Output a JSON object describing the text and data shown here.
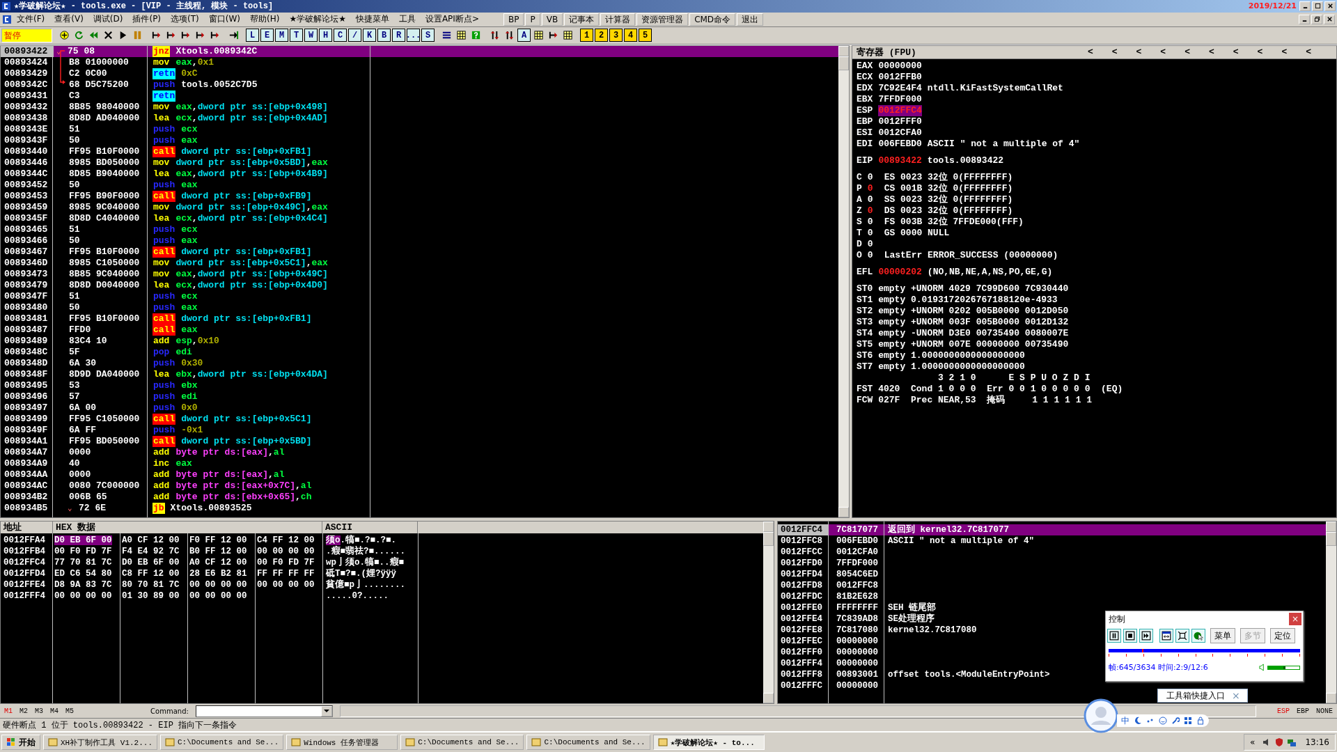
{
  "window": {
    "title": "★学破解论坛★ - tools.exe - [VIP - 主线程, 模块 - tools]",
    "clock": "2019/12/21"
  },
  "menu": {
    "items": [
      "文件(F)",
      "查看(V)",
      "调试(D)",
      "插件(P)",
      "选项(T)",
      "窗口(W)",
      "帮助(H)",
      "★学破解论坛★",
      "快捷菜单",
      "工具",
      "设置API断点>"
    ],
    "buttons": [
      "BP",
      "P",
      "VB",
      "记事本",
      "计算器",
      "资源管理器",
      "CMD命令",
      "退出"
    ]
  },
  "toolbar": {
    "status": "暂停",
    "groups": [
      [
        {
          "kind": "add"
        },
        {
          "kind": "refresh"
        },
        {
          "kind": "rewind"
        },
        {
          "kind": "close"
        },
        {
          "kind": "play"
        },
        {
          "kind": "pause"
        }
      ],
      [
        {
          "kind": "step"
        },
        {
          "kind": "step"
        },
        {
          "kind": "step"
        },
        {
          "kind": "step"
        },
        {
          "kind": "step"
        }
      ],
      [
        {
          "kind": "jump"
        }
      ],
      [
        {
          "kind": "letter",
          "label": "L"
        },
        {
          "kind": "letter",
          "label": "E"
        },
        {
          "kind": "letter",
          "label": "M"
        },
        {
          "kind": "letter",
          "label": "T"
        },
        {
          "kind": "letter",
          "label": "W"
        },
        {
          "kind": "letter",
          "label": "H"
        },
        {
          "kind": "letter",
          "label": "C"
        },
        {
          "kind": "letter",
          "label": "/"
        },
        {
          "kind": "letter",
          "label": "K"
        },
        {
          "kind": "letter",
          "label": "B"
        },
        {
          "kind": "letter",
          "label": "R"
        },
        {
          "kind": "letter",
          "label": "..."
        },
        {
          "kind": "letter",
          "label": "S"
        }
      ],
      [
        {
          "kind": "list"
        },
        {
          "kind": "grid"
        },
        {
          "kind": "help"
        }
      ],
      [
        {
          "kind": "swap"
        },
        {
          "kind": "swap"
        },
        {
          "kind": "letter",
          "label": "A"
        },
        {
          "kind": "grid"
        },
        {
          "kind": "step"
        },
        {
          "kind": "grid"
        }
      ],
      [
        {
          "kind": "number",
          "label": "1"
        },
        {
          "kind": "number",
          "label": "2"
        },
        {
          "kind": "number",
          "label": "3"
        },
        {
          "kind": "number",
          "label": "4"
        },
        {
          "kind": "number",
          "label": "5"
        }
      ]
    ]
  },
  "disassembly": [
    {
      "address": "00893422",
      "hex": "75 08",
      "mnemonic": "jnz",
      "kind": "jump",
      "ops": [
        {
          "text": "Xtools.0089342C",
          "kind": "txt"
        }
      ],
      "selected": true,
      "marker": "⌄"
    },
    {
      "address": "00893424",
      "hex": "B8 01000000",
      "mnemonic": "mov",
      "kind": "op",
      "ops": [
        {
          "text": "eax",
          "kind": "reg"
        },
        {
          "text": ",",
          "kind": "txt"
        },
        {
          "text": "0x1",
          "kind": "num"
        }
      ],
      "selected": false
    },
    {
      "address": "00893429",
      "hex": "C2 0C00",
      "mnemonic": "retn",
      "kind": "ret",
      "ops": [
        {
          "text": "0xC",
          "kind": "num"
        }
      ],
      "selected": false
    },
    {
      "address": "0089342C",
      "hex": "68 D5C75200",
      "mnemonic": "push",
      "kind": "stack",
      "ops": [
        {
          "text": "tools.0052C7D5",
          "kind": "txt"
        }
      ],
      "selected": false
    },
    {
      "address": "00893431",
      "hex": "C3",
      "mnemonic": "retn",
      "kind": "ret",
      "selected": false
    },
    {
      "address": "00893432",
      "hex": "8B85 98040000",
      "mnemonic": "mov",
      "kind": "op",
      "ops": [
        {
          "text": "eax",
          "kind": "reg"
        },
        {
          "text": ",",
          "kind": "txt"
        },
        {
          "text": "dword ptr ss:[ebp+0x498]",
          "kind": "mem"
        }
      ],
      "selected": false
    },
    {
      "address": "00893438",
      "hex": "8D8D AD040000",
      "mnemonic": "lea",
      "kind": "op",
      "ops": [
        {
          "text": "ecx",
          "kind": "reg"
        },
        {
          "text": ",",
          "kind": "txt"
        },
        {
          "text": "dword ptr ss:[ebp+0x4AD]",
          "kind": "mem"
        }
      ],
      "selected": false
    },
    {
      "address": "0089343E",
      "hex": "51",
      "mnemonic": "push",
      "kind": "stack",
      "ops": [
        {
          "text": "ecx",
          "kind": "reg"
        }
      ],
      "selected": false
    },
    {
      "address": "0089343F",
      "hex": "50",
      "mnemonic": "push",
      "kind": "stack",
      "ops": [
        {
          "text": "eax",
          "kind": "reg"
        }
      ],
      "selected": false
    },
    {
      "address": "00893440",
      "hex": "FF95 B10F0000",
      "mnemonic": "call",
      "kind": "call",
      "ops": [
        {
          "text": "dword ptr ss:[ebp+0xFB1]",
          "kind": "mem"
        }
      ],
      "selected": false
    },
    {
      "address": "00893446",
      "hex": "8985 BD050000",
      "mnemonic": "mov",
      "kind": "op",
      "ops": [
        {
          "text": "dword ptr ss:[ebp+0x5BD]",
          "kind": "mem"
        },
        {
          "text": ",",
          "kind": "txt"
        },
        {
          "text": "eax",
          "kind": "reg"
        }
      ],
      "selected": false
    },
    {
      "address": "0089344C",
      "hex": "8D85 B9040000",
      "mnemonic": "lea",
      "kind": "op",
      "ops": [
        {
          "text": "eax",
          "kind": "reg"
        },
        {
          "text": ",",
          "kind": "txt"
        },
        {
          "text": "dword ptr ss:[ebp+0x4B9]",
          "kind": "mem"
        }
      ],
      "selected": false
    },
    {
      "address": "00893452",
      "hex": "50",
      "mnemonic": "push",
      "kind": "stack",
      "ops": [
        {
          "text": "eax",
          "kind": "reg"
        }
      ],
      "selected": false
    },
    {
      "address": "00893453",
      "hex": "FF95 B90F0000",
      "mnemonic": "call",
      "kind": "call",
      "ops": [
        {
          "text": "dword ptr ss:[ebp+0xFB9]",
          "kind": "mem"
        }
      ],
      "selected": false
    },
    {
      "address": "00893459",
      "hex": "8985 9C040000",
      "mnemonic": "mov",
      "kind": "op",
      "ops": [
        {
          "text": "dword ptr ss:[ebp+0x49C]",
          "kind": "mem"
        },
        {
          "text": ",",
          "kind": "txt"
        },
        {
          "text": "eax",
          "kind": "reg"
        }
      ],
      "selected": false
    },
    {
      "address": "0089345F",
      "hex": "8D8D C4040000",
      "mnemonic": "lea",
      "kind": "op",
      "ops": [
        {
          "text": "ecx",
          "kind": "reg"
        },
        {
          "text": ",",
          "kind": "txt"
        },
        {
          "text": "dword ptr ss:[ebp+0x4C4]",
          "kind": "mem"
        }
      ],
      "selected": false
    },
    {
      "address": "00893465",
      "hex": "51",
      "mnemonic": "push",
      "kind": "stack",
      "ops": [
        {
          "text": "ecx",
          "kind": "reg"
        }
      ],
      "selected": false
    },
    {
      "address": "00893466",
      "hex": "50",
      "mnemonic": "push",
      "kind": "stack",
      "ops": [
        {
          "text": "eax",
          "kind": "reg"
        }
      ],
      "selected": false
    },
    {
      "address": "00893467",
      "hex": "FF95 B10F0000",
      "mnemonic": "call",
      "kind": "call",
      "ops": [
        {
          "text": "dword ptr ss:[ebp+0xFB1]",
          "kind": "mem"
        }
      ],
      "selected": false
    },
    {
      "address": "0089346D",
      "hex": "8985 C1050000",
      "mnemonic": "mov",
      "kind": "op",
      "ops": [
        {
          "text": "dword ptr ss:[ebp+0x5C1]",
          "kind": "mem"
        },
        {
          "text": ",",
          "kind": "txt"
        },
        {
          "text": "eax",
          "kind": "reg"
        }
      ],
      "selected": false
    },
    {
      "address": "00893473",
      "hex": "8B85 9C040000",
      "mnemonic": "mov",
      "kind": "op",
      "ops": [
        {
          "text": "eax",
          "kind": "reg"
        },
        {
          "text": ",",
          "kind": "txt"
        },
        {
          "text": "dword ptr ss:[ebp+0x49C]",
          "kind": "mem"
        }
      ],
      "selected": false
    },
    {
      "address": "00893479",
      "hex": "8D8D D0040000",
      "mnemonic": "lea",
      "kind": "op",
      "ops": [
        {
          "text": "ecx",
          "kind": "reg"
        },
        {
          "text": ",",
          "kind": "txt"
        },
        {
          "text": "dword ptr ss:[ebp+0x4D0]",
          "kind": "mem"
        }
      ],
      "selected": false
    },
    {
      "address": "0089347F",
      "hex": "51",
      "mnemonic": "push",
      "kind": "stack",
      "ops": [
        {
          "text": "ecx",
          "kind": "reg"
        }
      ],
      "selected": false
    },
    {
      "address": "00893480",
      "hex": "50",
      "mnemonic": "push",
      "kind": "stack",
      "ops": [
        {
          "text": "eax",
          "kind": "reg"
        }
      ],
      "selected": false
    },
    {
      "address": "00893481",
      "hex": "FF95 B10F0000",
      "mnemonic": "call",
      "kind": "call",
      "ops": [
        {
          "text": "dword ptr ss:[ebp+0xFB1]",
          "kind": "mem"
        }
      ],
      "selected": false
    },
    {
      "address": "00893487",
      "hex": "FFD0",
      "mnemonic": "call",
      "kind": "call",
      "ops": [
        {
          "text": "eax",
          "kind": "reg"
        }
      ],
      "selected": false
    },
    {
      "address": "00893489",
      "hex": "83C4 10",
      "mnemonic": "add",
      "kind": "op",
      "ops": [
        {
          "text": "esp",
          "kind": "reg"
        },
        {
          "text": ",",
          "kind": "txt"
        },
        {
          "text": "0x10",
          "kind": "num"
        }
      ],
      "selected": false
    },
    {
      "address": "0089348C",
      "hex": "5F",
      "mnemonic": "pop",
      "kind": "stack",
      "ops": [
        {
          "text": "edi",
          "kind": "reg"
        }
      ],
      "selected": false
    },
    {
      "address": "0089348D",
      "hex": "6A 30",
      "mnemonic": "push",
      "kind": "stack",
      "ops": [
        {
          "text": "0x30",
          "kind": "num"
        }
      ],
      "selected": false
    },
    {
      "address": "0089348F",
      "hex": "8D9D DA040000",
      "mnemonic": "lea",
      "kind": "op",
      "ops": [
        {
          "text": "ebx",
          "kind": "reg"
        },
        {
          "text": ",",
          "kind": "txt"
        },
        {
          "text": "dword ptr ss:[ebp+0x4DA]",
          "kind": "mem"
        }
      ],
      "selected": false
    },
    {
      "address": "00893495",
      "hex": "53",
      "mnemonic": "push",
      "kind": "stack",
      "ops": [
        {
          "text": "ebx",
          "kind": "reg"
        }
      ],
      "selected": false
    },
    {
      "address": "00893496",
      "hex": "57",
      "mnemonic": "push",
      "kind": "stack",
      "ops": [
        {
          "text": "edi",
          "kind": "reg"
        }
      ],
      "selected": false
    },
    {
      "address": "00893497",
      "hex": "6A 00",
      "mnemonic": "push",
      "kind": "stack",
      "ops": [
        {
          "text": "0x0",
          "kind": "num"
        }
      ],
      "selected": false
    },
    {
      "address": "00893499",
      "hex": "FF95 C1050000",
      "mnemonic": "call",
      "kind": "call",
      "ops": [
        {
          "text": "dword ptr ss:[ebp+0x5C1]",
          "kind": "mem"
        }
      ],
      "selected": false
    },
    {
      "address": "0089349F",
      "hex": "6A FF",
      "mnemonic": "push",
      "kind": "stack",
      "ops": [
        {
          "text": "-0x1",
          "kind": "num"
        }
      ],
      "selected": false
    },
    {
      "address": "008934A1",
      "hex": "FF95 BD050000",
      "mnemonic": "call",
      "kind": "call",
      "ops": [
        {
          "text": "dword ptr ss:[ebp+0x5BD]",
          "kind": "mem"
        }
      ],
      "selected": false
    },
    {
      "address": "008934A7",
      "hex": "0000",
      "mnemonic": "add",
      "kind": "op",
      "ops": [
        {
          "text": "byte ptr ds:[eax]",
          "kind": "byte"
        },
        {
          "text": ",",
          "kind": "txt"
        },
        {
          "text": "al",
          "kind": "reg"
        }
      ],
      "selected": false
    },
    {
      "address": "008934A9",
      "hex": "40",
      "mnemonic": "inc",
      "kind": "op",
      "ops": [
        {
          "text": "eax",
          "kind": "reg"
        }
      ],
      "selected": false
    },
    {
      "address": "008934AA",
      "hex": "0000",
      "mnemonic": "add",
      "kind": "op",
      "ops": [
        {
          "text": "byte ptr ds:[eax]",
          "kind": "byte"
        },
        {
          "text": ",",
          "kind": "txt"
        },
        {
          "text": "al",
          "kind": "reg"
        }
      ],
      "selected": false
    },
    {
      "address": "008934AC",
      "hex": "0080 7C000000",
      "mnemonic": "add",
      "kind": "op",
      "ops": [
        {
          "text": "byte ptr ds:[eax+0x7C]",
          "kind": "byte"
        },
        {
          "text": ",",
          "kind": "txt"
        },
        {
          "text": "al",
          "kind": "reg"
        }
      ],
      "selected": false
    },
    {
      "address": "008934B2",
      "hex": "006B 65",
      "mnemonic": "add",
      "kind": "op",
      "ops": [
        {
          "text": "byte ptr ds:[ebx+0x65]",
          "kind": "byte"
        },
        {
          "text": ",",
          "kind": "txt"
        },
        {
          "text": "ch",
          "kind": "reg"
        }
      ],
      "selected": false
    },
    {
      "address": "008934B5",
      "hex": "72 6E",
      "mnemonic": "jb",
      "kind": "jump",
      "ops": [
        {
          "text": "Xtools.00893525",
          "kind": "txt"
        }
      ],
      "selected": false,
      "marker": "⌄"
    }
  ],
  "registers": {
    "title": "寄存器 (FPU)",
    "arrows": [
      "<",
      "<",
      "<",
      "<",
      "<",
      "<",
      "<",
      "<",
      "<",
      "<"
    ],
    "general": [
      {
        "name": "EAX",
        "value": "00000000",
        "changed": false,
        "selected": false
      },
      {
        "name": "ECX",
        "value": "0012FFB0",
        "changed": false,
        "selected": false
      },
      {
        "name": "EDX",
        "value": "7C92E4F4",
        "comment": "ntdll.KiFastSystemCallRet",
        "changed": false,
        "selected": false
      },
      {
        "name": "EBX",
        "value": "7FFDF000",
        "changed": false,
        "selected": false
      },
      {
        "name": "ESP",
        "value": "0012FFC4",
        "changed": true,
        "selected": true
      },
      {
        "name": "EBP",
        "value": "0012FFF0",
        "changed": false,
        "selected": false
      },
      {
        "name": "ESI",
        "value": "0012CFA0",
        "changed": false,
        "selected": false
      },
      {
        "name": "EDI",
        "value": "006FEBD0",
        "comment": "ASCII \" not a multiple of 4\"",
        "changed": false,
        "selected": false
      }
    ],
    "eip": {
      "name": "EIP",
      "value": "00893422",
      "comment": "tools.00893422",
      "changed": true
    },
    "flags": [
      {
        "flag": "C",
        "value": "0",
        "changed": false,
        "detail": "ES 0023 32位 0(FFFFFFFF)"
      },
      {
        "flag": "P",
        "value": "0",
        "changed": true,
        "detail": "CS 001B 32位 0(FFFFFFFF)"
      },
      {
        "flag": "A",
        "value": "0",
        "changed": false,
        "detail": "SS 0023 32位 0(FFFFFFFF)"
      },
      {
        "flag": "Z",
        "value": "0",
        "changed": true,
        "detail": "DS 0023 32位 0(FFFFFFFF)"
      },
      {
        "flag": "S",
        "value": "0",
        "changed": false,
        "detail": "FS 003B 32位 7FFDE000(FFF)"
      },
      {
        "flag": "T",
        "value": "0",
        "changed": false,
        "detail": "GS 0000 NULL"
      },
      {
        "flag": "D",
        "value": "0",
        "changed": false
      },
      {
        "flag": "O",
        "value": "0",
        "changed": false,
        "detail": "LastErr ERROR_SUCCESS (00000000)"
      }
    ],
    "efl": {
      "name": "EFL",
      "value": "00000202",
      "comment": "(NO,NB,NE,A,NS,PO,GE,G)",
      "changed": true
    },
    "fpu": [
      "ST0 empty +UNORM 4029 7C99D600 7C930440",
      "ST1 empty 0.0193172026767188120e-4933",
      "ST2 empty +UNORM 0202 005B0000 0012D050",
      "ST3 empty +UNORM 003F 005B0000 0012D132",
      "ST4 empty -UNORM D3E0 00735490 0080007E",
      "ST5 empty +UNORM 007E 00000000 00735490",
      "ST6 empty 1.0000000000000000000",
      "ST7 empty 1.0000000000000000000"
    ],
    "fpu_status": [
      "               3 2 1 0      E S P U O Z D I",
      "FST 4020  Cond 1 0 0 0  Err 0 0 1 0 0 0 0 0  (EQ)",
      "FCW 027F  Prec NEAR,53  掩码     1 1 1 1 1 1"
    ]
  },
  "dump": {
    "columns": [
      "地址",
      "HEX 数据",
      "ASCII"
    ],
    "rows": [
      {
        "address": "0012FFA4",
        "groups": [
          {
            "hex": "D0 EB 6F 00",
            "selected": true
          },
          {
            "hex": "A0 CF 12 00",
            "selected": false
          },
          {
            "hex": "F0 FF 12 00",
            "selected": false
          },
          {
            "hex": "C4 FF 12 00",
            "selected": false
          }
        ],
        "ascii_highlight": "须o",
        "ascii": ".犒■.?■.?■."
      },
      {
        "address": "0012FFB4",
        "groups": [
          {
            "hex": "00 F0 FD 7F",
            "selected": false
          },
          {
            "hex": "F4 E4 92 7C",
            "selected": false
          },
          {
            "hex": "B0 FF 12 00",
            "selected": false
          },
          {
            "hex": "00 00 00 00",
            "selected": false
          }
        ],
        "ascii": ".瘕■翡祛?■......"
      },
      {
        "address": "0012FFC4",
        "groups": [
          {
            "hex": "77 70 81 7C",
            "selected": false
          },
          {
            "hex": "D0 EB 6F 00",
            "selected": false
          },
          {
            "hex": "A0 CF 12 00",
            "selected": false
          },
          {
            "hex": "00 F0 FD 7F",
            "selected": false
          }
        ],
        "ascii": "wp亅须o.犒■..瘕■"
      },
      {
        "address": "0012FFD4",
        "groups": [
          {
            "hex": "ED C6 54 80",
            "selected": false
          },
          {
            "hex": "C8 FF 12 00",
            "selected": false
          },
          {
            "hex": "28 E6 B2 81",
            "selected": false
          },
          {
            "hex": "FF FF FF FF",
            "selected": false
          }
        ],
        "ascii": "砥T■?■.(娌?ÿÿÿ"
      },
      {
        "address": "0012FFE4",
        "groups": [
          {
            "hex": "D8 9A 83 7C",
            "selected": false
          },
          {
            "hex": "80 70 81 7C",
            "selected": false
          },
          {
            "hex": "00 00 00 00",
            "selected": false
          },
          {
            "hex": "00 00 00 00",
            "selected": false
          }
        ],
        "ascii": "貧億■p亅........"
      },
      {
        "address": "0012FFF4",
        "groups": [
          {
            "hex": "00 00 00 00",
            "selected": false
          },
          {
            "hex": "01 30 89 00",
            "selected": false
          },
          {
            "hex": "00 00 00 00",
            "selected": false
          }
        ],
        "ascii": ".....0?....."
      }
    ]
  },
  "stack": [
    {
      "address": "0012FFC4",
      "value": "7C817077",
      "comment": "返回到 kernel32.7C817077",
      "selected": true
    },
    {
      "address": "0012FFC8",
      "value": "006FEBD0",
      "comment": "ASCII \" not a multiple of 4\"",
      "selected": false
    },
    {
      "address": "0012FFCC",
      "value": "0012CFA0",
      "selected": false
    },
    {
      "address": "0012FFD0",
      "value": "7FFDF000",
      "selected": false
    },
    {
      "address": "0012FFD4",
      "value": "8054C6ED",
      "selected": false
    },
    {
      "address": "0012FFD8",
      "value": "0012FFC8",
      "selected": false
    },
    {
      "address": "0012FFDC",
      "value": "81B2E628",
      "selected": false
    },
    {
      "address": "0012FFE0",
      "value": "FFFFFFFF",
      "comment": "SEH 链尾部",
      "selected": false
    },
    {
      "address": "0012FFE4",
      "value": "7C839AD8",
      "comment": "SE处理程序",
      "selected": false
    },
    {
      "address": "0012FFE8",
      "value": "7C817080",
      "comment": "kernel32.7C817080",
      "selected": false
    },
    {
      "address": "0012FFEC",
      "value": "00000000",
      "selected": false
    },
    {
      "address": "0012FFF0",
      "value": "00000000",
      "selected": false
    },
    {
      "address": "0012FFF4",
      "value": "00000000",
      "selected": false
    },
    {
      "address": "0012FFF8",
      "value": "00893001",
      "comment": "offset tools.<ModuleEntryPoint>",
      "selected": false
    },
    {
      "address": "0012FFFC",
      "value": "00000000",
      "selected": false
    }
  ],
  "player": {
    "title": "控制",
    "close": "×",
    "buttons": [
      {
        "label": "菜单",
        "disabled": false
      },
      {
        "label": "多节",
        "disabled": true
      },
      {
        "label": "定位",
        "disabled": false
      }
    ],
    "progress": {
      "level": 0.18
    },
    "info": "帧:645/3634 时间:2:9/12:6",
    "volume": {
      "level": 0.55
    }
  },
  "tooltip": {
    "text": "工具箱快捷入口",
    "close": "×"
  },
  "ime": {
    "label": "中"
  },
  "command_bar": {
    "tabs": [
      {
        "label": "M1",
        "selected": true
      },
      {
        "label": "M2",
        "selected": false
      },
      {
        "label": "M3",
        "selected": false
      },
      {
        "label": "M4",
        "selected": false
      },
      {
        "label": "M5",
        "selected": false
      }
    ],
    "label": "Command:",
    "registers": [
      {
        "label": "ESP",
        "selected": true
      },
      {
        "label": "EBP",
        "selected": false
      },
      {
        "label": "NONE",
        "selected": false
      }
    ]
  },
  "status_bar": "硬件断点 1 位于 tools.00893422 - EIP 指向下一条指令",
  "taskbar": {
    "start": "开始",
    "tasks": [
      {
        "label": "XH补丁制作工具 V1.2...",
        "selected": false
      },
      {
        "label": "C:\\Documents and Se...",
        "selected": false
      },
      {
        "label": "Windows 任务管理器",
        "selected": false
      },
      {
        "label": "C:\\Documents and Se...",
        "selected": false
      },
      {
        "label": "C:\\Documents and Se...",
        "selected": false
      },
      {
        "label": "★学破解论坛★ - to...",
        "selected": true
      }
    ],
    "expand": "«",
    "time": "13:16"
  }
}
